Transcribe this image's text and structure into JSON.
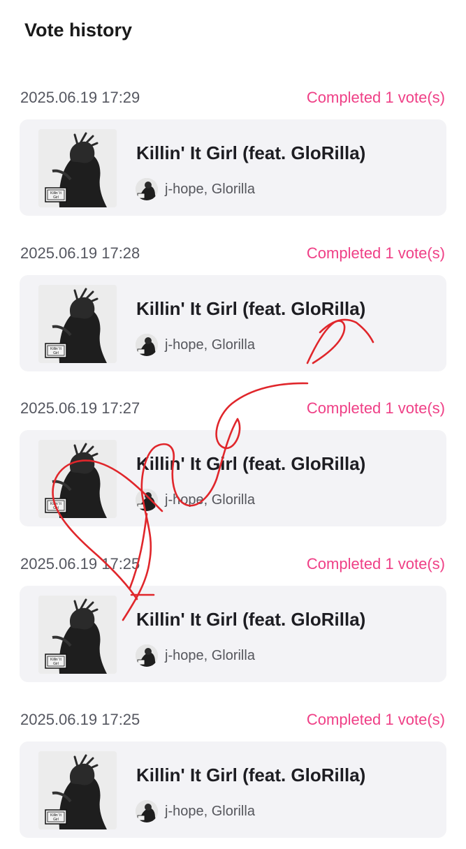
{
  "header": {
    "title": "Vote history"
  },
  "colors": {
    "accent": "#ef3f86",
    "card_bg": "#f3f3f6",
    "scribble": "#e0262b"
  },
  "entries": [
    {
      "timestamp": "2025.06.19 17:29",
      "status": "Completed 1 vote(s)",
      "song": "Killin' It Girl (feat. GloRilla)",
      "artists": "j-hope, Glorilla",
      "cover_icon": "album-cover-image"
    },
    {
      "timestamp": "2025.06.19 17:28",
      "status": "Completed 1 vote(s)",
      "song": "Killin' It Girl (feat. GloRilla)",
      "artists": "j-hope, Glorilla",
      "cover_icon": "album-cover-image"
    },
    {
      "timestamp": "2025.06.19 17:27",
      "status": "Completed 1 vote(s)",
      "song": "Killin' It Girl (feat. GloRilla)",
      "artists": "j-hope, Glorilla",
      "cover_icon": "album-cover-image"
    },
    {
      "timestamp": "2025.06.19 17:25",
      "status": "Completed 1 vote(s)",
      "song": "Killin' It Girl (feat. GloRilla)",
      "artists": "j-hope, Glorilla",
      "cover_icon": "album-cover-image"
    },
    {
      "timestamp": "2025.06.19 17:25",
      "status": "Completed 1 vote(s)",
      "song": "Killin' It Girl (feat. GloRilla)",
      "artists": "j-hope, Glorilla",
      "cover_icon": "album-cover-image"
    }
  ]
}
